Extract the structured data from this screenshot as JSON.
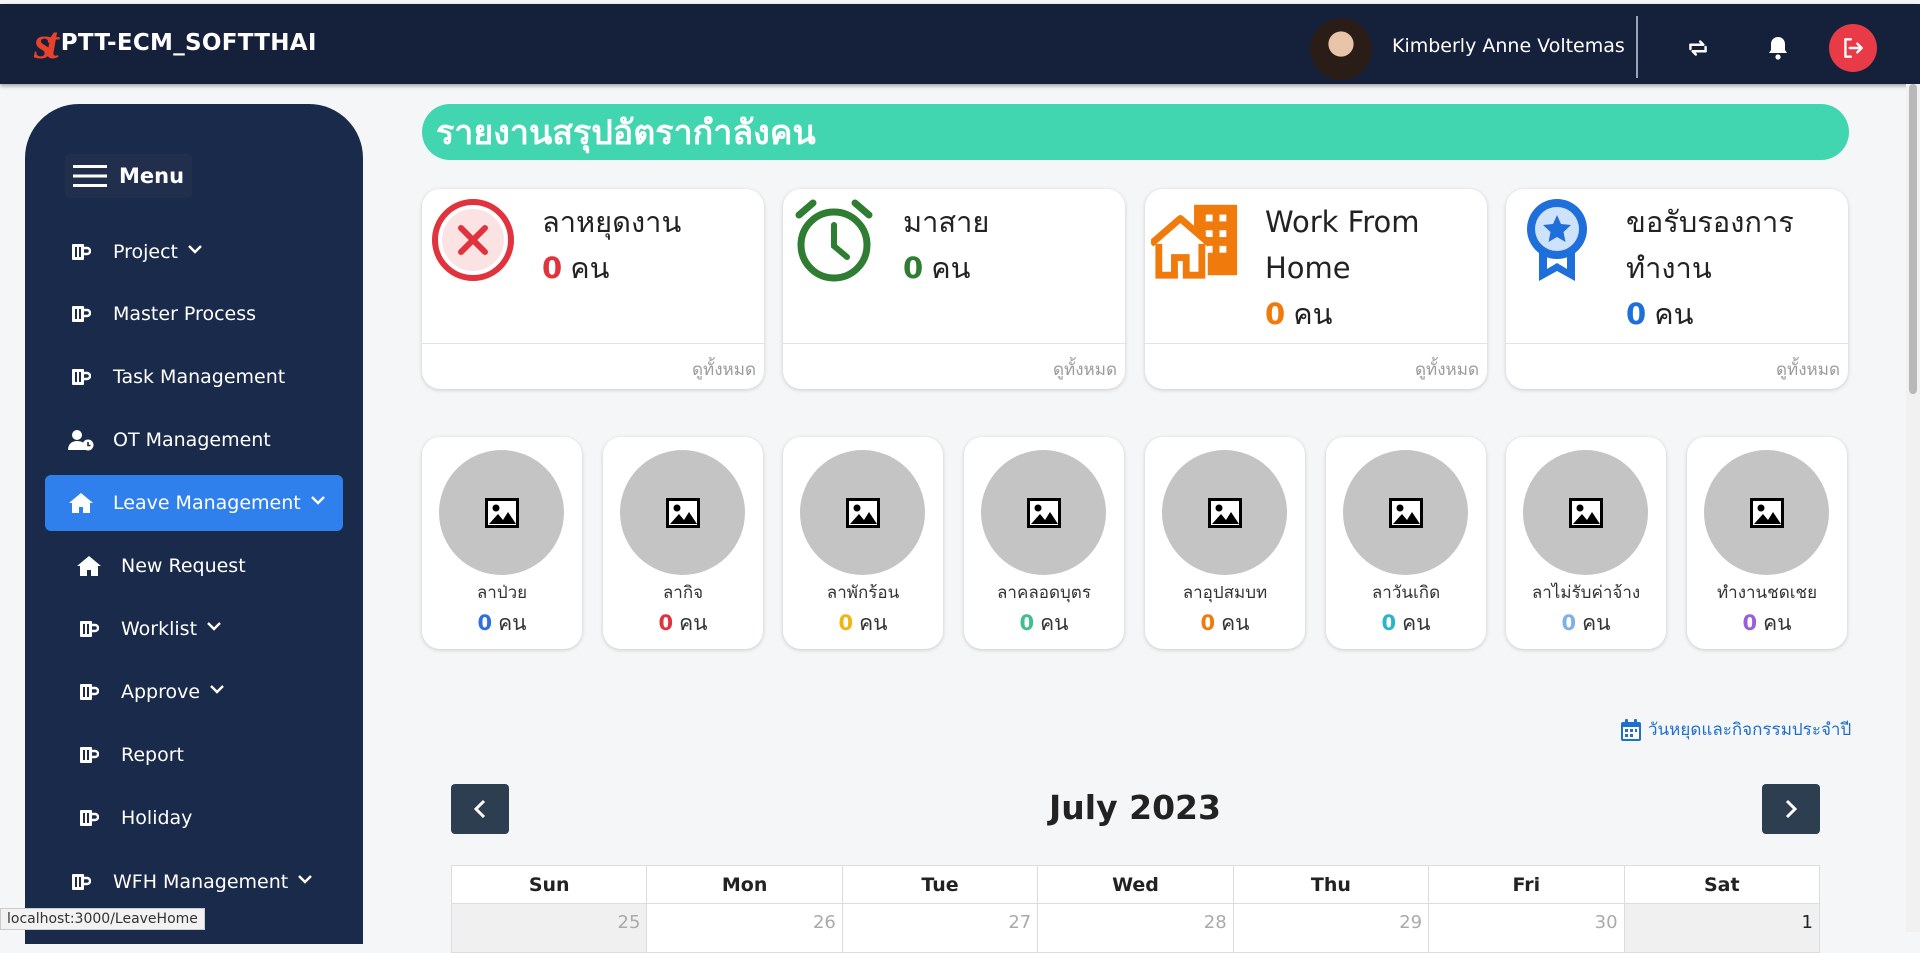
{
  "header": {
    "logo_mark": "st",
    "app_name": "PTT-ECM_SOFTTHAI",
    "user_name": "Kimberly Anne Voltemas"
  },
  "sidebar": {
    "menu_label": "Menu",
    "items": [
      {
        "label": "Project"
      },
      {
        "label": "Master Process"
      },
      {
        "label": "Task Management"
      },
      {
        "label": "OT Management"
      },
      {
        "label": "Leave Management"
      },
      {
        "label": "New Request"
      },
      {
        "label": "Worklist"
      },
      {
        "label": "Approve"
      },
      {
        "label": "Report"
      },
      {
        "label": "Holiday"
      },
      {
        "label": "WFH Management"
      }
    ]
  },
  "main": {
    "title": "รายงานสรุปอัตรากำลังคน",
    "stats": [
      {
        "label": "ลาหยุดงาน",
        "count": "0",
        "unit": "คน",
        "footer": "ดูทั้งหมด",
        "color": "#e0333e",
        "icon": "cancel-icon"
      },
      {
        "label": "มาสาย",
        "count": "0",
        "unit": "คน",
        "footer": "ดูทั้งหมด",
        "color": "#2e7d32",
        "icon": "alarm-clock-icon"
      },
      {
        "label": "Work From Home",
        "count": "0",
        "unit": "คน",
        "footer": "ดูทั้งหมด",
        "color": "#f07a0c",
        "icon": "home-building-icon"
      },
      {
        "label": "ขอรับรองการทำงาน",
        "count": "0",
        "unit": "คน",
        "footer": "ดูทั้งหมด",
        "color": "#1e6fd9",
        "icon": "award-badge-icon"
      }
    ],
    "leave_types": [
      {
        "label": "ลาป่วย",
        "count": "0",
        "unit": "คน",
        "color": "#2f6fe0"
      },
      {
        "label": "ลากิจ",
        "count": "0",
        "unit": "คน",
        "color": "#e0333e"
      },
      {
        "label": "ลาพักร้อน",
        "count": "0",
        "unit": "คน",
        "color": "#f2b410"
      },
      {
        "label": "ลาคลอดบุตร",
        "count": "0",
        "unit": "คน",
        "color": "#3fbf8a"
      },
      {
        "label": "ลาอุปสมบท",
        "count": "0",
        "unit": "คน",
        "color": "#f07a0c"
      },
      {
        "label": "ลาวันเกิด",
        "count": "0",
        "unit": "คน",
        "color": "#29b5c9"
      },
      {
        "label": "ลาไม่รับค่าจ้าง",
        "count": "0",
        "unit": "คน",
        "color": "#7fb0e6"
      },
      {
        "label": "ทำงานชดเชย",
        "count": "0",
        "unit": "คน",
        "color": "#9a5ed9"
      }
    ],
    "holiday_link": "วันหยุดและกิจกรรมประจำปี",
    "calendar": {
      "title": "July 2023",
      "weekdays": [
        "Sun",
        "Mon",
        "Tue",
        "Wed",
        "Thu",
        "Fri",
        "Sat"
      ],
      "first_row": [
        "25",
        "26",
        "27",
        "28",
        "29",
        "30",
        "1"
      ]
    }
  },
  "status_bar": {
    "url": "localhost:3000/LeaveHome"
  }
}
